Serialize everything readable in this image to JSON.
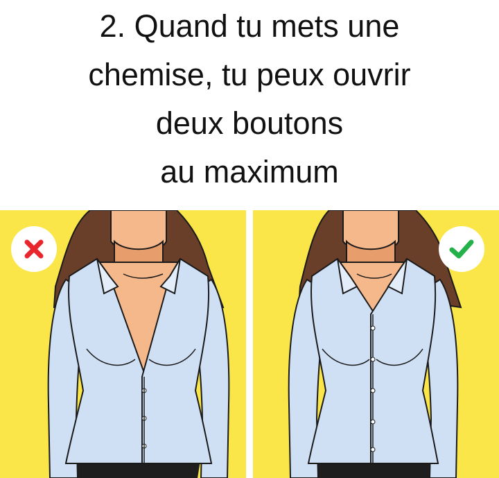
{
  "title": {
    "lines": [
      "2. Quand tu mets une",
      "chemise, tu peux ouvrir",
      "deux boutons",
      "au maximum"
    ]
  },
  "panels": [
    {
      "id": "wrong",
      "verdict": "incorrect",
      "icon": "red-x-icon",
      "accent": "#e8262d",
      "open_buttons": "many"
    },
    {
      "id": "right",
      "verdict": "correct",
      "icon": "green-check-icon",
      "accent": "#25b14a",
      "open_buttons": 2
    }
  ],
  "colors": {
    "background_yellow": "#fbe649",
    "shirt": "#cfe0f5",
    "hair": "#6a3f2a",
    "skin": "#f4b88a",
    "pants": "#1e1e1e"
  }
}
